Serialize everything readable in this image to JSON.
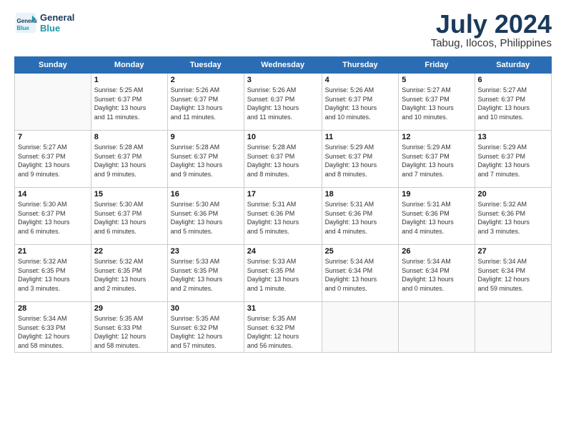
{
  "logo": {
    "line1": "General",
    "line2": "Blue"
  },
  "title": "July 2024",
  "location": "Tabug, Ilocos, Philippines",
  "days_header": [
    "Sunday",
    "Monday",
    "Tuesday",
    "Wednesday",
    "Thursday",
    "Friday",
    "Saturday"
  ],
  "weeks": [
    [
      {
        "num": "",
        "info": ""
      },
      {
        "num": "1",
        "info": "Sunrise: 5:25 AM\nSunset: 6:37 PM\nDaylight: 13 hours\nand 11 minutes."
      },
      {
        "num": "2",
        "info": "Sunrise: 5:26 AM\nSunset: 6:37 PM\nDaylight: 13 hours\nand 11 minutes."
      },
      {
        "num": "3",
        "info": "Sunrise: 5:26 AM\nSunset: 6:37 PM\nDaylight: 13 hours\nand 11 minutes."
      },
      {
        "num": "4",
        "info": "Sunrise: 5:26 AM\nSunset: 6:37 PM\nDaylight: 13 hours\nand 10 minutes."
      },
      {
        "num": "5",
        "info": "Sunrise: 5:27 AM\nSunset: 6:37 PM\nDaylight: 13 hours\nand 10 minutes."
      },
      {
        "num": "6",
        "info": "Sunrise: 5:27 AM\nSunset: 6:37 PM\nDaylight: 13 hours\nand 10 minutes."
      }
    ],
    [
      {
        "num": "7",
        "info": "Sunrise: 5:27 AM\nSunset: 6:37 PM\nDaylight: 13 hours\nand 9 minutes."
      },
      {
        "num": "8",
        "info": "Sunrise: 5:28 AM\nSunset: 6:37 PM\nDaylight: 13 hours\nand 9 minutes."
      },
      {
        "num": "9",
        "info": "Sunrise: 5:28 AM\nSunset: 6:37 PM\nDaylight: 13 hours\nand 9 minutes."
      },
      {
        "num": "10",
        "info": "Sunrise: 5:28 AM\nSunset: 6:37 PM\nDaylight: 13 hours\nand 8 minutes."
      },
      {
        "num": "11",
        "info": "Sunrise: 5:29 AM\nSunset: 6:37 PM\nDaylight: 13 hours\nand 8 minutes."
      },
      {
        "num": "12",
        "info": "Sunrise: 5:29 AM\nSunset: 6:37 PM\nDaylight: 13 hours\nand 7 minutes."
      },
      {
        "num": "13",
        "info": "Sunrise: 5:29 AM\nSunset: 6:37 PM\nDaylight: 13 hours\nand 7 minutes."
      }
    ],
    [
      {
        "num": "14",
        "info": "Sunrise: 5:30 AM\nSunset: 6:37 PM\nDaylight: 13 hours\nand 6 minutes."
      },
      {
        "num": "15",
        "info": "Sunrise: 5:30 AM\nSunset: 6:37 PM\nDaylight: 13 hours\nand 6 minutes."
      },
      {
        "num": "16",
        "info": "Sunrise: 5:30 AM\nSunset: 6:36 PM\nDaylight: 13 hours\nand 5 minutes."
      },
      {
        "num": "17",
        "info": "Sunrise: 5:31 AM\nSunset: 6:36 PM\nDaylight: 13 hours\nand 5 minutes."
      },
      {
        "num": "18",
        "info": "Sunrise: 5:31 AM\nSunset: 6:36 PM\nDaylight: 13 hours\nand 4 minutes."
      },
      {
        "num": "19",
        "info": "Sunrise: 5:31 AM\nSunset: 6:36 PM\nDaylight: 13 hours\nand 4 minutes."
      },
      {
        "num": "20",
        "info": "Sunrise: 5:32 AM\nSunset: 6:36 PM\nDaylight: 13 hours\nand 3 minutes."
      }
    ],
    [
      {
        "num": "21",
        "info": "Sunrise: 5:32 AM\nSunset: 6:35 PM\nDaylight: 13 hours\nand 3 minutes."
      },
      {
        "num": "22",
        "info": "Sunrise: 5:32 AM\nSunset: 6:35 PM\nDaylight: 13 hours\nand 2 minutes."
      },
      {
        "num": "23",
        "info": "Sunrise: 5:33 AM\nSunset: 6:35 PM\nDaylight: 13 hours\nand 2 minutes."
      },
      {
        "num": "24",
        "info": "Sunrise: 5:33 AM\nSunset: 6:35 PM\nDaylight: 13 hours\nand 1 minute."
      },
      {
        "num": "25",
        "info": "Sunrise: 5:34 AM\nSunset: 6:34 PM\nDaylight: 13 hours\nand 0 minutes."
      },
      {
        "num": "26",
        "info": "Sunrise: 5:34 AM\nSunset: 6:34 PM\nDaylight: 13 hours\nand 0 minutes."
      },
      {
        "num": "27",
        "info": "Sunrise: 5:34 AM\nSunset: 6:34 PM\nDaylight: 12 hours\nand 59 minutes."
      }
    ],
    [
      {
        "num": "28",
        "info": "Sunrise: 5:34 AM\nSunset: 6:33 PM\nDaylight: 12 hours\nand 58 minutes."
      },
      {
        "num": "29",
        "info": "Sunrise: 5:35 AM\nSunset: 6:33 PM\nDaylight: 12 hours\nand 58 minutes."
      },
      {
        "num": "30",
        "info": "Sunrise: 5:35 AM\nSunset: 6:32 PM\nDaylight: 12 hours\nand 57 minutes."
      },
      {
        "num": "31",
        "info": "Sunrise: 5:35 AM\nSunset: 6:32 PM\nDaylight: 12 hours\nand 56 minutes."
      },
      {
        "num": "",
        "info": ""
      },
      {
        "num": "",
        "info": ""
      },
      {
        "num": "",
        "info": ""
      }
    ]
  ]
}
